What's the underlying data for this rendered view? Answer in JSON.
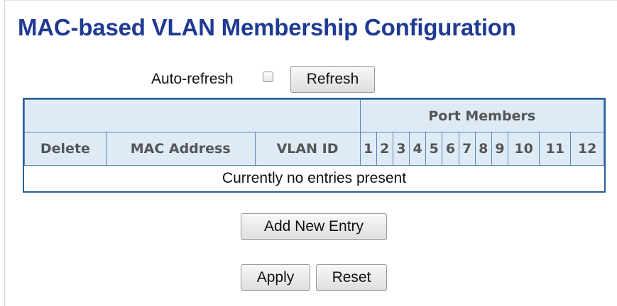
{
  "page": {
    "title": "MAC-based VLAN Membership Configuration",
    "title_color": "#1f3a93"
  },
  "toolbar": {
    "auto_refresh_label": "Auto-refresh",
    "auto_refresh_checked": false,
    "refresh_label": "Refresh"
  },
  "table": {
    "group_header": "Port Members",
    "columns": [
      "Delete",
      "MAC Address",
      "VLAN ID"
    ],
    "ports": [
      "1",
      "2",
      "3",
      "4",
      "5",
      "6",
      "7",
      "8",
      "9",
      "10",
      "11",
      "12"
    ],
    "empty_message": "Currently no entries present",
    "header_bg": "#deebf7",
    "border_color": "#2c5d98"
  },
  "actions": {
    "add_label": "Add New Entry",
    "apply_label": "Apply",
    "reset_label": "Reset"
  }
}
